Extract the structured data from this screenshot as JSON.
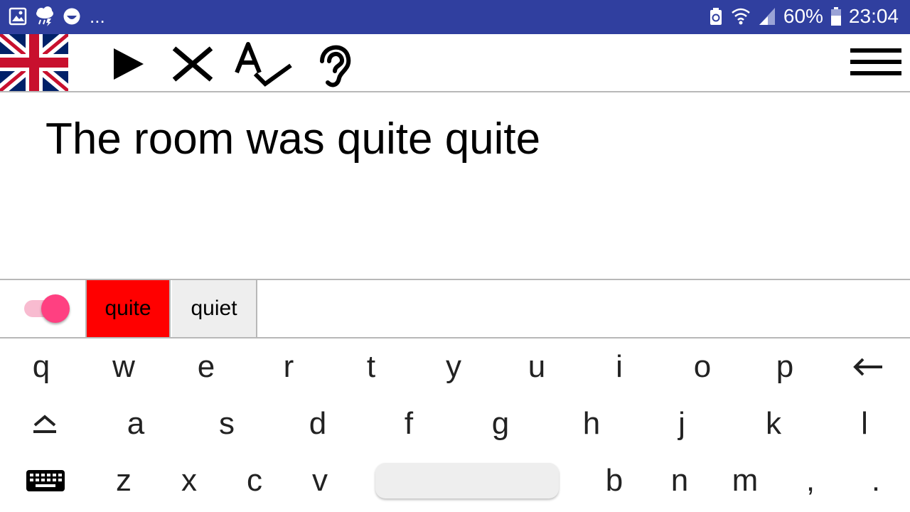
{
  "status_bar": {
    "battery": "60%",
    "time": "23:04",
    "overflow": "..."
  },
  "toolbar": {
    "language_flag_icon": "uk-flag-icon",
    "play_icon": "play-icon",
    "clear_icon": "close-icon",
    "spellcheck_icon": "spellcheck-icon",
    "hearing_icon": "hearing-icon",
    "menu_icon": "hamburger-menu-icon"
  },
  "editor": {
    "text": "The room was quite quite"
  },
  "suggestions": {
    "toggle_on": true,
    "items": [
      {
        "label": "quite",
        "selected": true,
        "color": "#ff0000"
      },
      {
        "label": "quiet",
        "selected": false,
        "color": "#eeeeee"
      }
    ]
  },
  "keyboard": {
    "row1": [
      "q",
      "w",
      "e",
      "r",
      "t",
      "y",
      "u",
      "i",
      "o",
      "p"
    ],
    "row2": [
      "a",
      "s",
      "d",
      "f",
      "g",
      "h",
      "j",
      "k",
      "l"
    ],
    "row3_left": [
      "z",
      "x",
      "c",
      "v"
    ],
    "row3_right": [
      "b",
      "n",
      "m",
      ",",
      "."
    ],
    "backspace_icon": "backspace-arrow-icon",
    "shift_icon": "shift-icon",
    "keyboard_icon": "keyboard-icon"
  },
  "colors": {
    "status_bar": "#303f9f",
    "toggle_knob": "#ff4081",
    "toggle_track": "#f8bbd0",
    "selected_suggestion": "#ff0000"
  }
}
